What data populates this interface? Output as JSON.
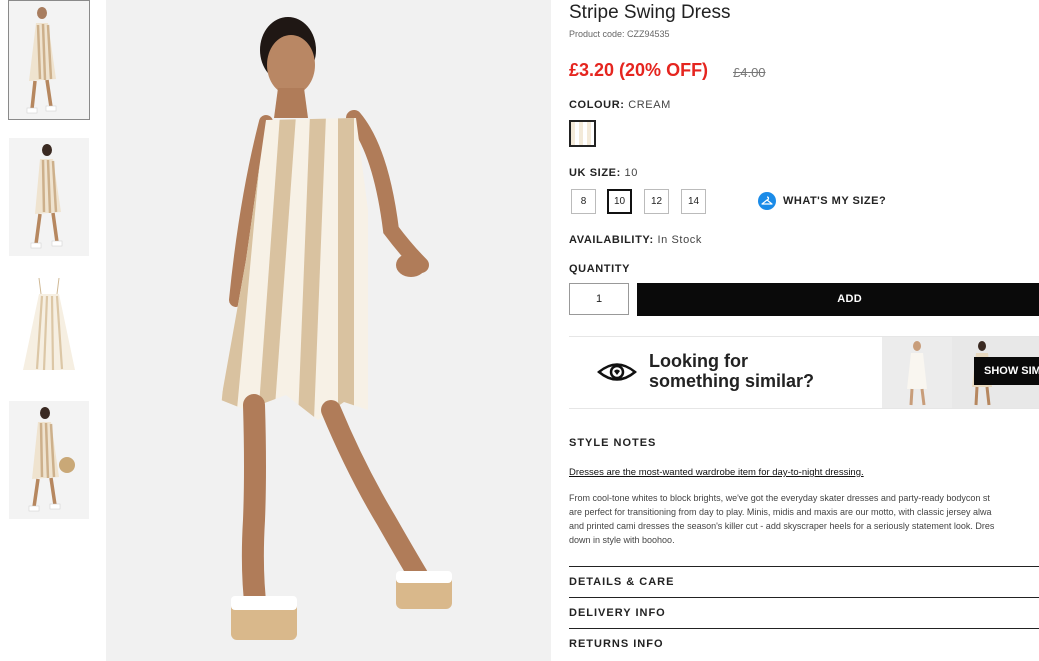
{
  "product": {
    "title": "Stripe Swing Dress",
    "code": "Product code: CZZ94535",
    "price_now": "£3.20 (20% OFF)",
    "price_was": "£4.00"
  },
  "colour": {
    "label": "COLOUR:",
    "value": "CREAM"
  },
  "size": {
    "label": "UK SIZE:",
    "value": "10",
    "options": [
      "8",
      "10",
      "12",
      "14"
    ],
    "help_label": "WHAT'S MY SIZE?"
  },
  "availability": {
    "label": "AVAILABILITY:",
    "value": "In Stock"
  },
  "quantity": {
    "label": "QUANTITY",
    "value": "1"
  },
  "cart": {
    "add_label": "ADD TO BAG"
  },
  "similar": {
    "line1": "Looking for",
    "line2": "something similar?",
    "button_label": "SHOW SIM"
  },
  "style_notes": {
    "title": "STYLE NOTES",
    "headline": "Dresses are the most-wanted wardrobe item for day-to-night dressing.",
    "lines": [
      "From cool-tone whites to block brights, we've got the everyday skater dresses and party-ready bodycon st",
      "are perfect for transitioning from day to play. Minis, midis and maxis are our motto, with classic jersey alwa",
      "and printed cami dresses the season's killer cut - add skyscraper heels for a seriously statement look. Dres",
      "down in style with boohoo."
    ]
  },
  "sections": {
    "details": "DETAILS & CARE",
    "delivery": "DELIVERY INFO",
    "returns": "RETURNS INFO"
  },
  "colors": {
    "sale_red": "#e5251f",
    "button_black": "#0a0a0a",
    "help_blue": "#1a8be8",
    "stripe_tan": "#d9c2a0",
    "stripe_cream": "#f7f1e6"
  },
  "icons": {
    "size_help": "hanger-icon",
    "similar": "eye-icon"
  }
}
